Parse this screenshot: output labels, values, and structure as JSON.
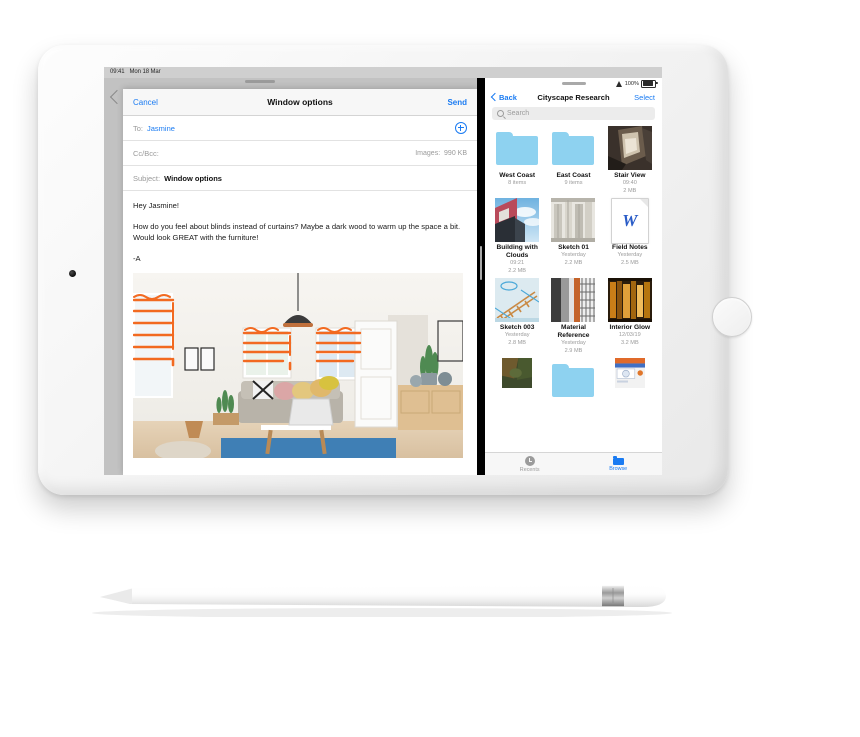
{
  "device": {
    "name": "iPad mini",
    "home_button": "home-button",
    "camera": "front-camera"
  },
  "statusbar": {
    "time": "09:41",
    "date": "Mon 18 Mar",
    "battery_percent": "100%",
    "wifi_icon": "wifi-icon",
    "battery_icon": "battery-icon"
  },
  "mail": {
    "back_icon": "chevron-left-icon",
    "compose_icon": "compose-pencil-icon",
    "drag_handle": "drag-handle",
    "compose": {
      "cancel_label": "Cancel",
      "title": "Window options",
      "send_label": "Send",
      "to_label": "To:",
      "to_value": "Jasmine",
      "add_recipient_icon": "add-circle-icon",
      "ccbcc_label": "Cc/Bcc:",
      "images_label": "Images:",
      "images_size": "990 KB",
      "subject_label": "Subject:",
      "subject_value": "Window options",
      "body": [
        "Hey Jasmine!",
        "How do you feel about blinds instead of curtains? Maybe a dark wood to warm up the space a bit. Would look GREAT with the furniture!",
        "-A"
      ],
      "attachment_name": "living-room-photo-with-orange-blind-annotations"
    }
  },
  "divider": {
    "grabber": "split-view-grabber"
  },
  "files": {
    "statusbar": {
      "battery_percent": "100%",
      "wifi_icon": "wifi-icon"
    },
    "nav": {
      "back_label": "Back",
      "title": "Cityscape Research",
      "select_label": "Select"
    },
    "search": {
      "placeholder": "Search",
      "icon": "search-icon"
    },
    "items": [
      {
        "name": "West Coast",
        "meta1": "8 items",
        "meta2": "",
        "kind": "folder"
      },
      {
        "name": "East Coast",
        "meta1": "9 items",
        "meta2": "",
        "kind": "folder"
      },
      {
        "name": "Stair View",
        "meta1": "09:40",
        "meta2": "2 MB",
        "kind": "photo-stairwell"
      },
      {
        "name": "Building with Clouds",
        "meta1": "09:21",
        "meta2": "2.2 MB",
        "kind": "photo-building"
      },
      {
        "name": "Sketch 01",
        "meta1": "Yesterday",
        "meta2": "2.2 MB",
        "kind": "photo-columns"
      },
      {
        "name": "Field Notes",
        "meta1": "Yesterday",
        "meta2": "2.5 MB",
        "kind": "document-word"
      },
      {
        "name": "Sketch 003",
        "meta1": "Yesterday",
        "meta2": "2.8 MB",
        "kind": "photo-bridge-sketch"
      },
      {
        "name": "Material Reference",
        "meta1": "Yesterday",
        "meta2": "2.9 MB",
        "kind": "photo-material"
      },
      {
        "name": "Interior Glow",
        "meta1": "12/03/19",
        "meta2": "3.2 MB",
        "kind": "photo-interior"
      }
    ],
    "partial_row": [
      {
        "kind": "photo-dark-green"
      },
      {
        "kind": "folder"
      },
      {
        "kind": "magazine-cover"
      }
    ],
    "tabs": [
      {
        "label": "Recents",
        "icon": "clock-icon",
        "active": false
      },
      {
        "label": "Browse",
        "icon": "folder-icon",
        "active": true
      }
    ]
  },
  "accessory": {
    "pencil": "apple-pencil"
  },
  "colors": {
    "accent_blue": "#1a7bf2",
    "folder_blue": "#8ed2f0",
    "annotation_orange": "#f26a21"
  }
}
